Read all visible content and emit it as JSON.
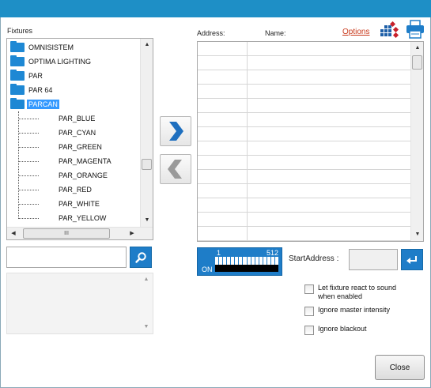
{
  "fixtures": {
    "label": "Fixtures",
    "folders": [
      {
        "label": "OMNISISTEM"
      },
      {
        "label": "OPTIMA LIGHTING"
      },
      {
        "label": "PAR"
      },
      {
        "label": "PAR 64"
      },
      {
        "label": "PARCAN"
      }
    ],
    "children": [
      "PAR_BLUE",
      "PAR_CYAN",
      "PAR_GREEN",
      "PAR_MAGENTA",
      "PAR_ORANGE",
      "PAR_RED",
      "PAR_WHITE",
      "PAR_YELLOW"
    ],
    "hscroll_glyph": "III"
  },
  "search": {
    "placeholder": ""
  },
  "patch": {
    "address_label": "Address:",
    "name_label": "Name:",
    "options_label": "Options"
  },
  "dmx": {
    "start": "1",
    "end": "512",
    "on_label": "ON"
  },
  "start_address": {
    "label": "StartAddress :",
    "value": ""
  },
  "options": {
    "react_sound": "Let fixture react to sound when enabled",
    "ignore_master": "Ignore master intensity",
    "ignore_blackout": "Ignore blackout"
  },
  "close_label": "Close",
  "colors": {
    "accent": "#1e7dc8",
    "title_bar": "#1e8fc6",
    "link": "#c8381a"
  }
}
